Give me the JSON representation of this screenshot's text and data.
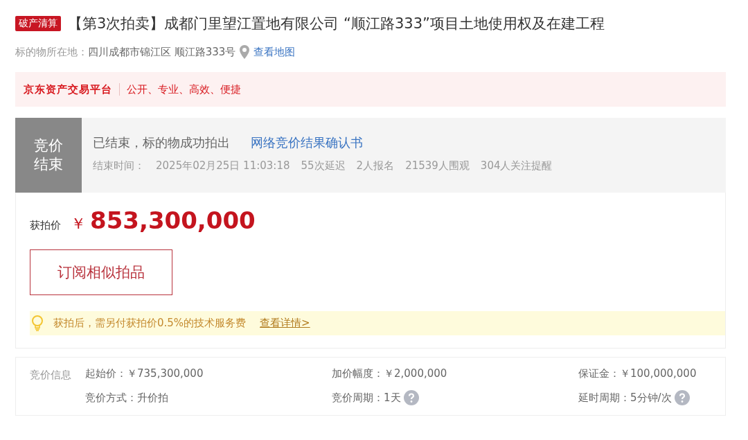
{
  "header": {
    "tag": "破产清算",
    "title": "【第3次拍卖】成都门里望江置地有限公司 “顺江路333”项目土地使用权及在建工程"
  },
  "location": {
    "label": "标的物所在地：",
    "address": "四川成都市锦江区 顺江路333号",
    "map_link": "查看地图"
  },
  "platform": {
    "name": "京东资产交易平台",
    "slogan": "公开、专业、高效、便捷"
  },
  "status": {
    "badge": "竞价结束",
    "message": "已结束，标的物成功拍出",
    "result_link": "网络竞价结果确认书",
    "end_label": "结束时间：",
    "end_time": "2025年02月25日 11:03:18",
    "stats": [
      "55次延迟",
      "2人报名",
      "21539人围观",
      "304人关注提醒"
    ]
  },
  "price": {
    "label": "获拍价",
    "currency": "￥",
    "amount": "853,300,000"
  },
  "subscribe_button": "订阅相似拍品",
  "notice": {
    "text": "获拍后，需另付获拍价0.5%的技术服务费",
    "link": "查看详情>"
  },
  "bid_info": {
    "title": "竞价信息",
    "items": [
      {
        "label": "起始价：",
        "value": "￥735,300,000",
        "help": false
      },
      {
        "label": "加价幅度：",
        "value": "￥2,000,000",
        "help": false
      },
      {
        "label": "保证金：",
        "value": "￥100,000,000",
        "help": false
      },
      {
        "label": "竞价方式：",
        "value": "升价拍",
        "help": false
      },
      {
        "label": "竞价周期：",
        "value": "1天",
        "help": true
      },
      {
        "label": "延时周期：",
        "value": "5分钟/次",
        "help": true
      }
    ]
  }
}
